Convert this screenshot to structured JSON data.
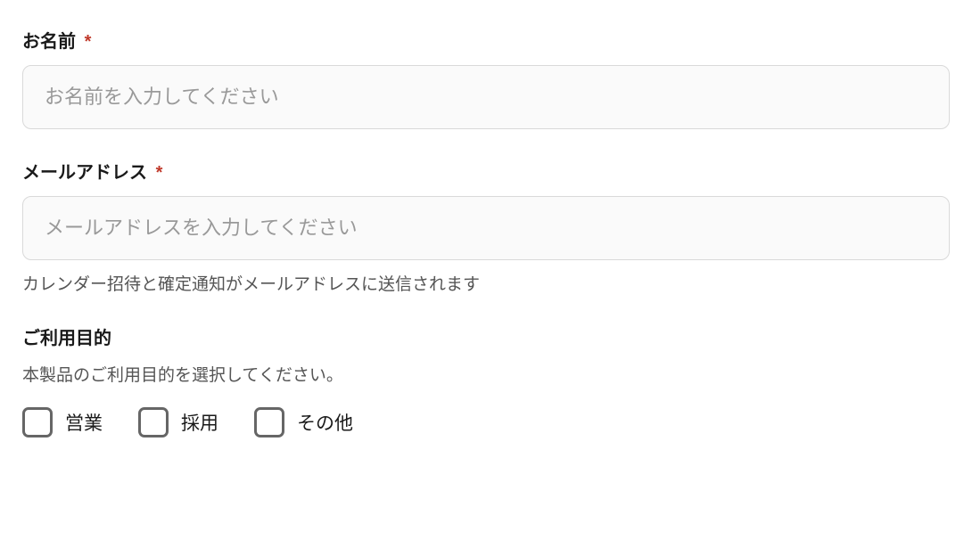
{
  "name_field": {
    "label": "お名前",
    "required_mark": "*",
    "placeholder": "お名前を入力してください"
  },
  "email_field": {
    "label": "メールアドレス",
    "required_mark": "*",
    "placeholder": "メールアドレスを入力してください",
    "help_text": "カレンダー招待と確定通知がメールアドレスに送信されます"
  },
  "purpose_field": {
    "label": "ご利用目的",
    "sub_text": "本製品のご利用目的を選択してください。",
    "options": {
      "sales": "営業",
      "recruitment": "採用",
      "other": "その他"
    }
  }
}
